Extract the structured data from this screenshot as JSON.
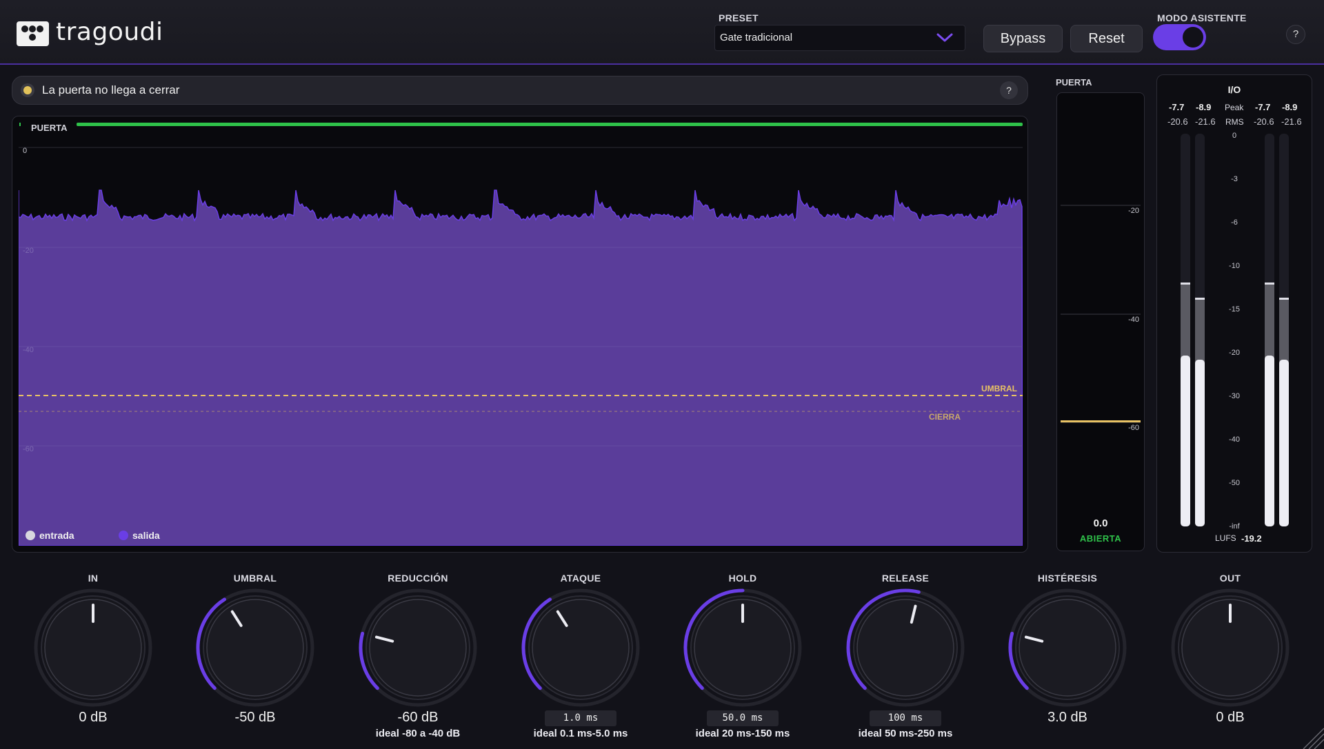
{
  "header": {
    "logo_text": "tragoudi",
    "preset_label": "PRESET",
    "preset_value": "Gate tradicional",
    "bypass_label": "Bypass",
    "reset_label": "Reset",
    "assistant_label": "MODO ASISTENTE",
    "assistant_on": true,
    "help_label": "?"
  },
  "alert": {
    "text": "La puerta no llega a cerrar",
    "help_label": "?",
    "status_color": "#e2c25a"
  },
  "graph": {
    "title": "PUERTA",
    "y_ticks": [
      "0",
      "-20",
      "-40",
      "-60"
    ],
    "threshold_label": "UMBRAL",
    "close_label": "CIERRA",
    "legend_input": "entrada",
    "legend_output": "salida",
    "colors": {
      "output": "#5a3d9a",
      "output_edge": "#6a3ee6",
      "threshold": "#e8c264",
      "gate_open": "#2fc24a"
    }
  },
  "gate_meter": {
    "title": "PUERTA",
    "ticks": [
      "-20",
      "-40",
      "-60"
    ],
    "value": "0.0",
    "state": "ABIERTA"
  },
  "io": {
    "title": "I/O",
    "in_peak_l": "-7.7",
    "in_peak_r": "-8.9",
    "out_peak_l": "-7.7",
    "out_peak_r": "-8.9",
    "peak_label": "Peak",
    "in_rms_l": "-20.6",
    "in_rms_r": "-21.6",
    "out_rms_l": "-20.6",
    "out_rms_r": "-21.6",
    "rms_label": "RMS",
    "scale": [
      "0",
      "-3",
      "-6",
      "-10",
      "-15",
      "-20",
      "-30",
      "-40",
      "-50",
      "-inf"
    ],
    "lufs_label": "LUFS",
    "lufs_value": "-19.2"
  },
  "knobs": [
    {
      "label": "IN",
      "value": "0 dB",
      "boxed": false,
      "hint": "",
      "fill": 0.5,
      "arc": false
    },
    {
      "label": "UMBRAL",
      "value": "-50 dB",
      "boxed": false,
      "hint": "",
      "fill": 0.38,
      "arc": true
    },
    {
      "label": "REDUCCIÓN",
      "value": "-60 dB",
      "boxed": false,
      "hint": "ideal -80 a -40 dB",
      "fill": 0.22,
      "arc": true
    },
    {
      "label": "ATAQUE",
      "value": "1.0 ms",
      "boxed": true,
      "hint": "ideal 0.1 ms-5.0 ms",
      "fill": 0.38,
      "arc": true
    },
    {
      "label": "HOLD",
      "value": "50.0 ms",
      "boxed": true,
      "hint": "ideal 20 ms-150 ms",
      "fill": 0.5,
      "arc": true
    },
    {
      "label": "RELEASE",
      "value": "100 ms",
      "boxed": true,
      "hint": "ideal 50 ms-250 ms",
      "fill": 0.55,
      "arc": true
    },
    {
      "label": "HISTÉRESIS",
      "value": "3.0 dB",
      "boxed": false,
      "hint": "",
      "fill": 0.22,
      "arc": true
    },
    {
      "label": "OUT",
      "value": "0 dB",
      "boxed": false,
      "hint": "",
      "fill": 0.5,
      "arc": false
    }
  ]
}
